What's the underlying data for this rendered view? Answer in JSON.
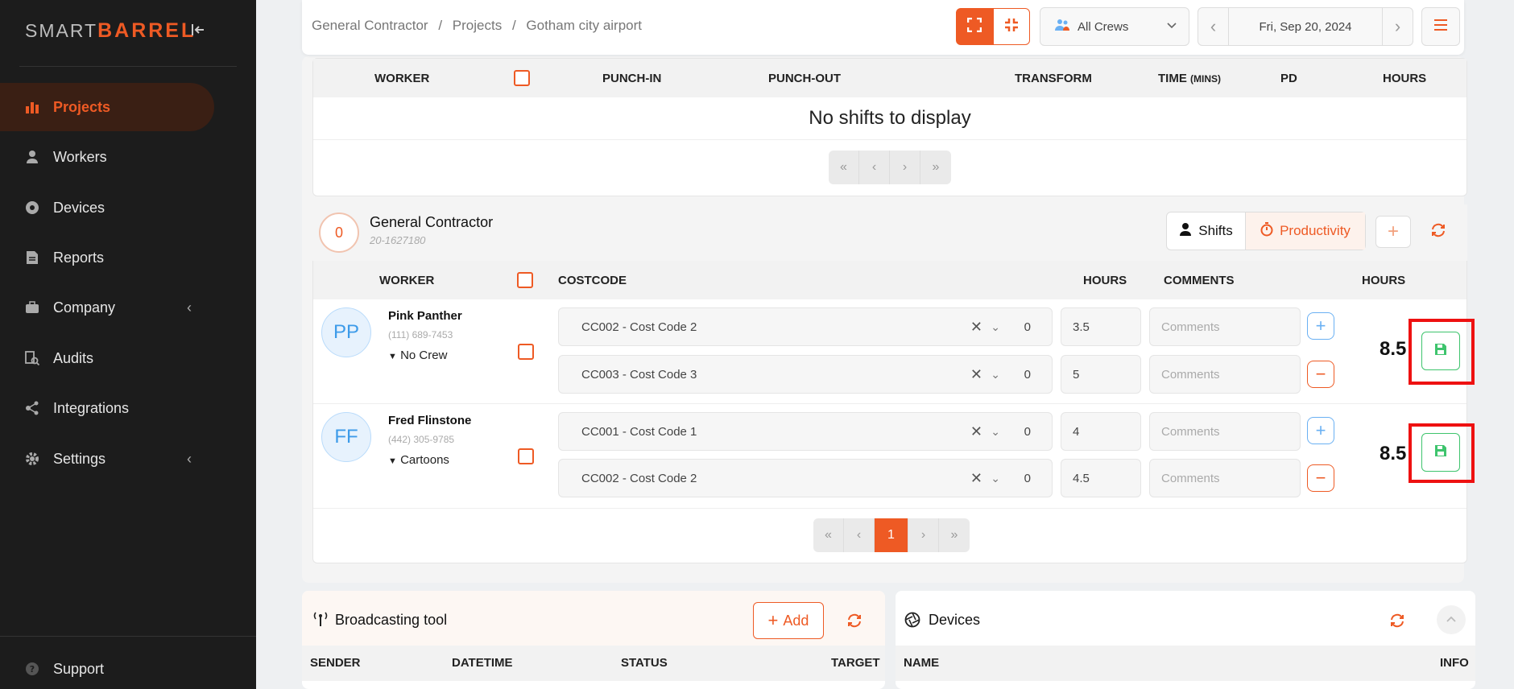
{
  "sidebar": {
    "logo_part1": "SMART",
    "logo_part2": "BARREL",
    "items": [
      {
        "label": "Projects",
        "icon": "chart-icon"
      },
      {
        "label": "Workers",
        "icon": "worker-icon"
      },
      {
        "label": "Devices",
        "icon": "devices-icon"
      },
      {
        "label": "Reports",
        "icon": "report-icon"
      },
      {
        "label": "Company",
        "icon": "briefcase-icon"
      },
      {
        "label": "Audits",
        "icon": "audit-icon"
      },
      {
        "label": "Integrations",
        "icon": "integrations-icon"
      },
      {
        "label": "Settings",
        "icon": "gear-icon"
      }
    ],
    "support": "Support"
  },
  "header": {
    "breadcrumb": [
      "General Contractor",
      "/",
      "Projects",
      "/",
      "Gotham city airport"
    ],
    "crews_select": "All Crews",
    "date": "Fri, Sep 20, 2024"
  },
  "shift_table": {
    "columns": [
      "WORKER",
      "PUNCH-IN",
      "PUNCH-OUT",
      "TRANSFORM",
      "TIME",
      "(MINS)",
      "PD",
      "HOURS"
    ],
    "empty": "No shifts to display",
    "pager": [
      "«",
      "‹",
      "›",
      "»"
    ]
  },
  "company": {
    "count": "0",
    "name": "General Contractor",
    "id": "20-1627180",
    "shifts_btn": "Shifts",
    "productivity_btn": "Productivity",
    "columns": [
      "WORKER",
      "COSTCODE",
      "HOURS",
      "COMMENTS",
      "HOURS"
    ],
    "workers": [
      {
        "initials": "PP",
        "name": "Pink Panther",
        "phone": "(111) 689-7453",
        "crew": "No Crew",
        "total": "8.5",
        "rows": [
          {
            "costcode": "CC002 - Cost Code 2",
            "num": "0",
            "hours": "3.5",
            "comments_placeholder": "Comments"
          },
          {
            "costcode": "CC003 - Cost Code 3",
            "num": "0",
            "hours": "5",
            "comments_placeholder": "Comments"
          }
        ]
      },
      {
        "initials": "FF",
        "name": "Fred Flinstone",
        "phone": "(442) 305-9785",
        "crew": "Cartoons",
        "total": "8.5",
        "rows": [
          {
            "costcode": "CC001 - Cost Code 1",
            "num": "0",
            "hours": "4",
            "comments_placeholder": "Comments"
          },
          {
            "costcode": "CC002 - Cost Code 2",
            "num": "0",
            "hours": "4.5",
            "comments_placeholder": "Comments"
          }
        ]
      }
    ],
    "pager": [
      "«",
      "‹",
      "1",
      "›",
      "»"
    ]
  },
  "broadcast": {
    "title": "Broadcasting tool",
    "add_btn": "Add",
    "columns": [
      "SENDER",
      "DATETIME",
      "STATUS",
      "TARGET"
    ]
  },
  "devices": {
    "title": "Devices",
    "columns": [
      "NAME",
      "INFO"
    ]
  },
  "colors": {
    "accent": "#ee5a24",
    "sidebar": "#1c1c1c",
    "save": "#3ec46d",
    "highlight": "#e11111"
  }
}
